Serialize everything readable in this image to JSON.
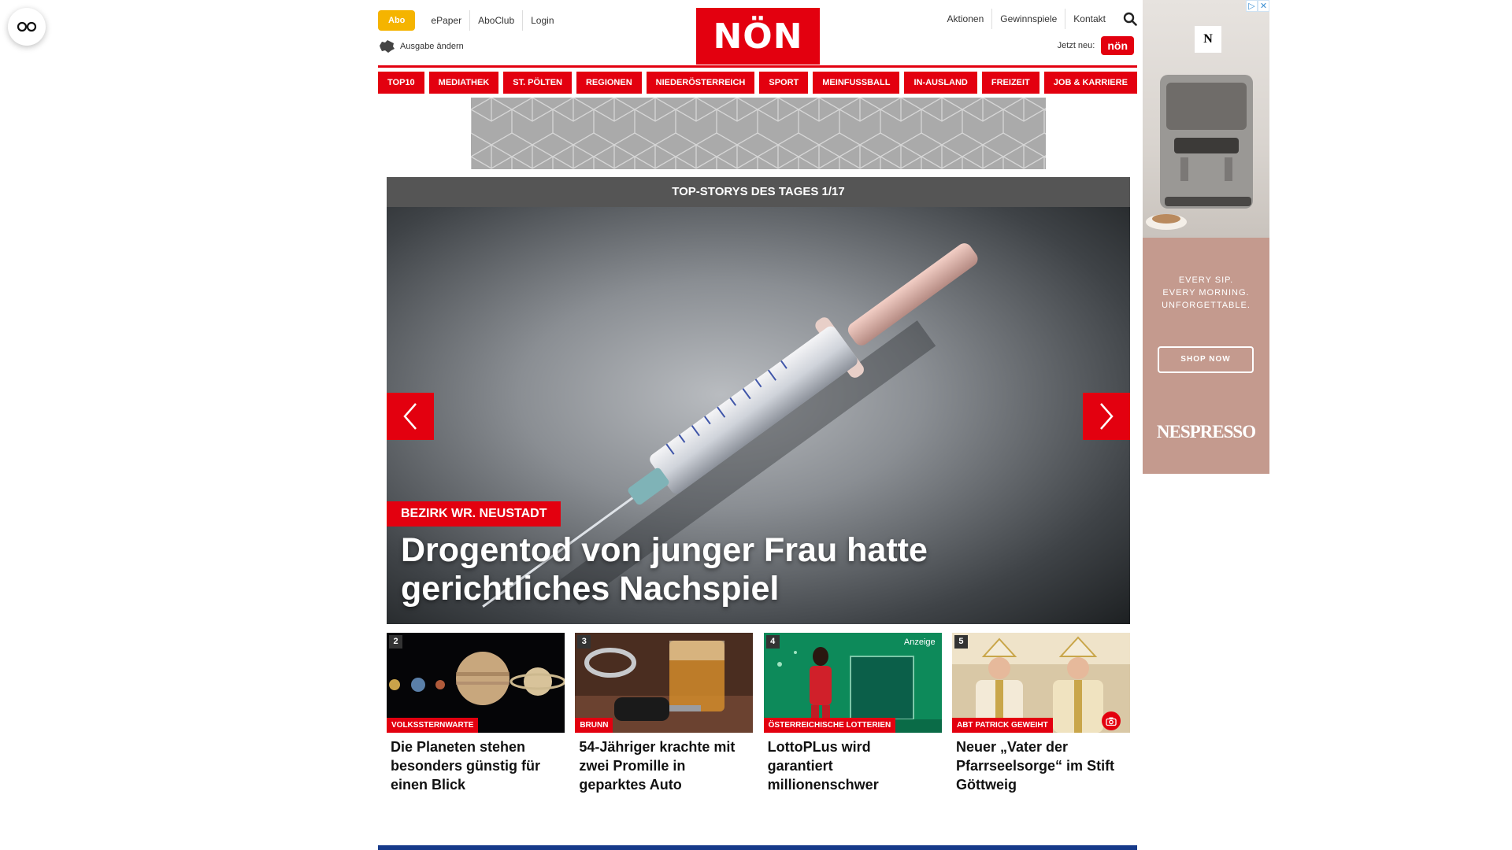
{
  "header": {
    "abo_label": "Abo",
    "top_links": [
      "ePaper",
      "AboClub",
      "Login"
    ],
    "edition_label": "Ausgabe ändern",
    "logo_text": "NÖN",
    "right_links": [
      "Aktionen",
      "Gewinnspiele",
      "Kontakt"
    ],
    "jetzt_label": "Jetzt neu:",
    "jetzt_badge": "nön"
  },
  "nav": {
    "items": [
      "TOP10",
      "MEDIATHEK",
      "ST. PÖLTEN",
      "REGIONEN",
      "NIEDERÖSTERREICH",
      "SPORT",
      "MEINFUSSBALL",
      "IN-AUSLAND",
      "FREIZEIT",
      "JOB & KARRIERE"
    ]
  },
  "stories": {
    "header": "TOP-STORYS DES TAGES 1/17",
    "hero": {
      "kicker": "BEZIRK WR. NEUSTADT",
      "title": "Drogentod von junger Frau hatte gerichtliches Nachspiel"
    },
    "cards": [
      {
        "num": "2",
        "tag": "VOLKSSTERNWARTE",
        "title": "Die Planeten stehen besonders günstig für einen Blick",
        "anzeige": ""
      },
      {
        "num": "3",
        "tag": "BRUNN",
        "title": "54-Jähriger krachte mit zwei Promille in geparktes Auto",
        "anzeige": ""
      },
      {
        "num": "4",
        "tag": "ÖSTERREICHISCHE LOTTERIEN",
        "title": "LottoPLus wird garantiert millionenschwer",
        "anzeige": "Anzeige"
      },
      {
        "num": "5",
        "tag": "ABT PATRICK GEWEIHT",
        "title": "Neuer „Vater der Pfarrseelsorge“ im Stift Göttweig",
        "anzeige": ""
      }
    ]
  },
  "side_ad": {
    "logo": "N",
    "line1": "EVERY SIP.",
    "line2": "EVERY MORNING.",
    "line3": "UNFORGETTABLE.",
    "button": "SHOP NOW",
    "brand": "NESPRESSO"
  },
  "colors": {
    "brand_red": "#e3000f",
    "abo_yellow": "#f5b400",
    "stories_header": "#555555",
    "footer_blue": "#163a8a"
  }
}
